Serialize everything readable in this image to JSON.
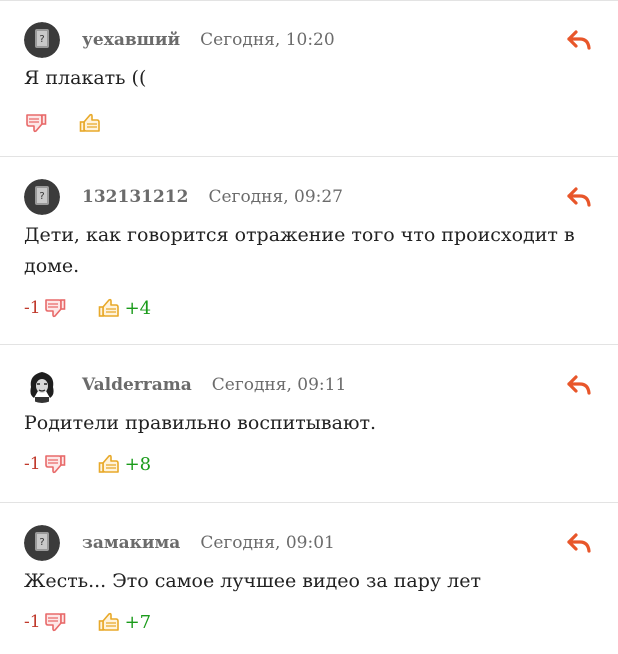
{
  "colors": {
    "reply_accent": "#e8562a",
    "thumb_down": "#e86a6a",
    "thumb_up": "#e8a92a",
    "negative": "#c0392b",
    "positive": "#1a9b1a",
    "divider": "#e3e3e3"
  },
  "icons": {
    "reply": "reply-arrow-icon",
    "dislike": "thumb-down-icon",
    "like": "thumb-up-icon",
    "avatar_default": "default-avatar-icon"
  },
  "comments": [
    {
      "author": "уехавший",
      "time": "Сегодня, 10:20",
      "text": "Я плакать ((",
      "down": "",
      "up": ""
    },
    {
      "author": "132131212",
      "time": "Сегодня, 09:27",
      "text": "Дети, как говорится отражение того что происходит в доме.",
      "down": "-1",
      "up": "+4"
    },
    {
      "author": "Valderrama",
      "time": "Сегодня, 09:11",
      "text": "Родители правильно воспитывают.",
      "down": "-1",
      "up": "+8"
    },
    {
      "author": "замакима",
      "time": "Сегодня, 09:01",
      "text": "Жесть... Это самое лучшее видео за пару лет",
      "down": "-1",
      "up": "+7"
    }
  ]
}
